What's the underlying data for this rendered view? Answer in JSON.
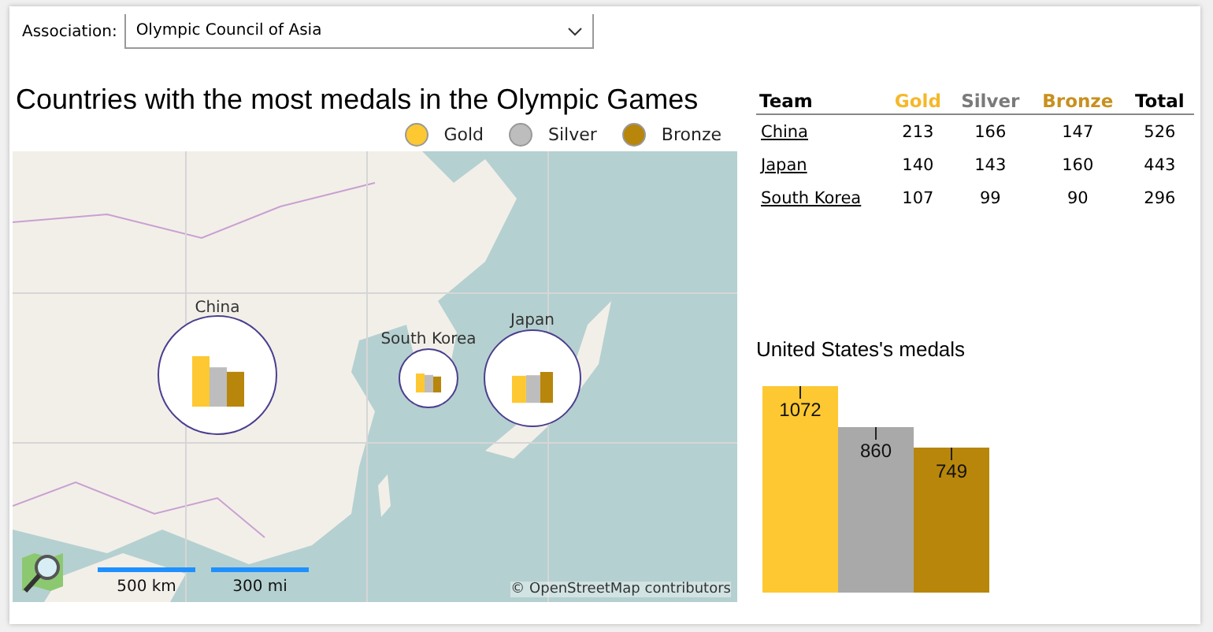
{
  "filter": {
    "label": "Association:",
    "value": "Olympic Council of Asia"
  },
  "map_panel": {
    "title": "Countries with the most medals in the Olympic Games",
    "legend": [
      {
        "name": "Gold",
        "color": "#fdc832"
      },
      {
        "name": "Silver",
        "color": "#bdbdbd"
      },
      {
        "name": "Bronze",
        "color": "#b8860b"
      }
    ],
    "markers": [
      {
        "name": "China"
      },
      {
        "name": "South Korea"
      },
      {
        "name": "Japan"
      }
    ],
    "scale": [
      "500 km",
      "300 mi"
    ],
    "attribution": "© OpenStreetMap contributors"
  },
  "table": {
    "columns": [
      {
        "name": "Team",
        "color": "#000000"
      },
      {
        "name": "Gold",
        "color": "#f5b82a"
      },
      {
        "name": "Silver",
        "color": "#7a7a7a"
      },
      {
        "name": "Bronze",
        "color": "#c8901e"
      },
      {
        "name": "Total",
        "color": "#000000"
      }
    ],
    "rows": [
      [
        "China",
        "213",
        "166",
        "147",
        "526"
      ],
      [
        "Japan",
        "140",
        "143",
        "160",
        "443"
      ],
      [
        "South Korea",
        "107",
        "99",
        "90",
        "296"
      ]
    ]
  },
  "chart_data": {
    "type": "bar",
    "title": "United States's medals",
    "data_labels": true,
    "series": [
      {
        "color": "#fdc832",
        "values": [
          1072
        ]
      },
      {
        "color": "#a9a9a9",
        "values": [
          860
        ]
      },
      {
        "color": "#b8860b",
        "values": [
          749
        ]
      }
    ]
  }
}
